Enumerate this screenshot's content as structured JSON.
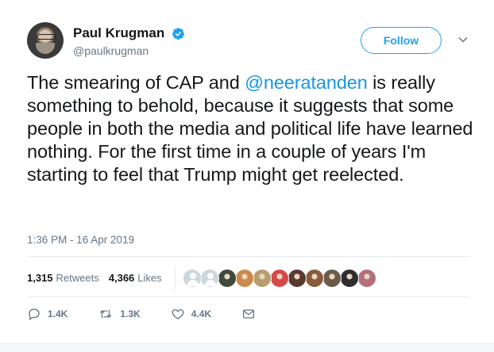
{
  "author": {
    "name": "Paul Krugman",
    "handle": "@paulkrugman",
    "verified_icon": "verified-badge-icon"
  },
  "follow_button": {
    "label": "Follow"
  },
  "menu_caret_icon": "chevron-down-icon",
  "tweet": {
    "text_segments": [
      {
        "text": "The smearing of CAP and ",
        "mention": false
      },
      {
        "text": "@neeratanden",
        "mention": true
      },
      {
        "text": " is really something to behold, because it suggests that some people in both the media and political life have learned nothing. For the first time in a couple of years I'm starting to feel that Trump might get reelected.",
        "mention": false
      }
    ],
    "timestamp": "1:36 PM - 16 Apr 2019"
  },
  "stats": {
    "retweets_count": "1,315",
    "retweets_label": "Retweets",
    "likes_count": "4,366",
    "likes_label": "Likes"
  },
  "likers": [
    {
      "type": "default-avatar",
      "color": "#ccd6dd"
    },
    {
      "type": "default-avatar",
      "color": "#ccd6dd"
    },
    {
      "type": "photo",
      "color": "#3e4a3a"
    },
    {
      "type": "photo",
      "color": "#c98a4b"
    },
    {
      "type": "photo",
      "color": "#b89d6e"
    },
    {
      "type": "photo",
      "color": "#d64a4a"
    },
    {
      "type": "photo",
      "color": "#5a3a2e"
    },
    {
      "type": "photo",
      "color": "#8a5a3c"
    },
    {
      "type": "photo",
      "color": "#6b5b4b"
    },
    {
      "type": "photo",
      "color": "#2e2e2e"
    },
    {
      "type": "photo",
      "color": "#b3707a"
    }
  ],
  "actions": {
    "reply_count": "1.4K",
    "retweet_count": "1.3K",
    "like_count": "4.4K"
  },
  "colors": {
    "accent": "#1da1f2",
    "mention": "#1b95e0",
    "muted": "#657786",
    "divider": "#e6ecf0"
  }
}
